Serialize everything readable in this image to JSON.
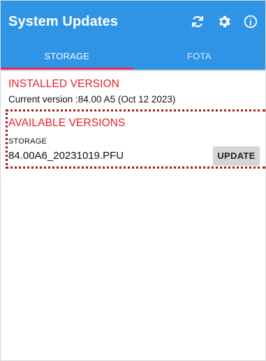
{
  "app_bar": {
    "title": "System Updates",
    "icons": [
      "refresh-icon",
      "gear-icon",
      "info-icon"
    ]
  },
  "tabs": [
    {
      "label": "STORAGE",
      "selected": true
    },
    {
      "label": "FOTA",
      "selected": false
    }
  ],
  "installed": {
    "header": "INSTALLED VERSION",
    "current_text": "Current version :84.00 A5 (Oct 12 2023)"
  },
  "available": {
    "header": "AVAILABLE VERSIONS",
    "items": [
      {
        "label": "STORAGE",
        "value": "84.00A6_20231019.PFU",
        "button": "UPDATE"
      }
    ]
  },
  "colors": {
    "primary": "#2f93e6",
    "tab_indicator": "#e62e62",
    "section_header": "#e8202b",
    "highlight_border": "#a61c1c"
  }
}
